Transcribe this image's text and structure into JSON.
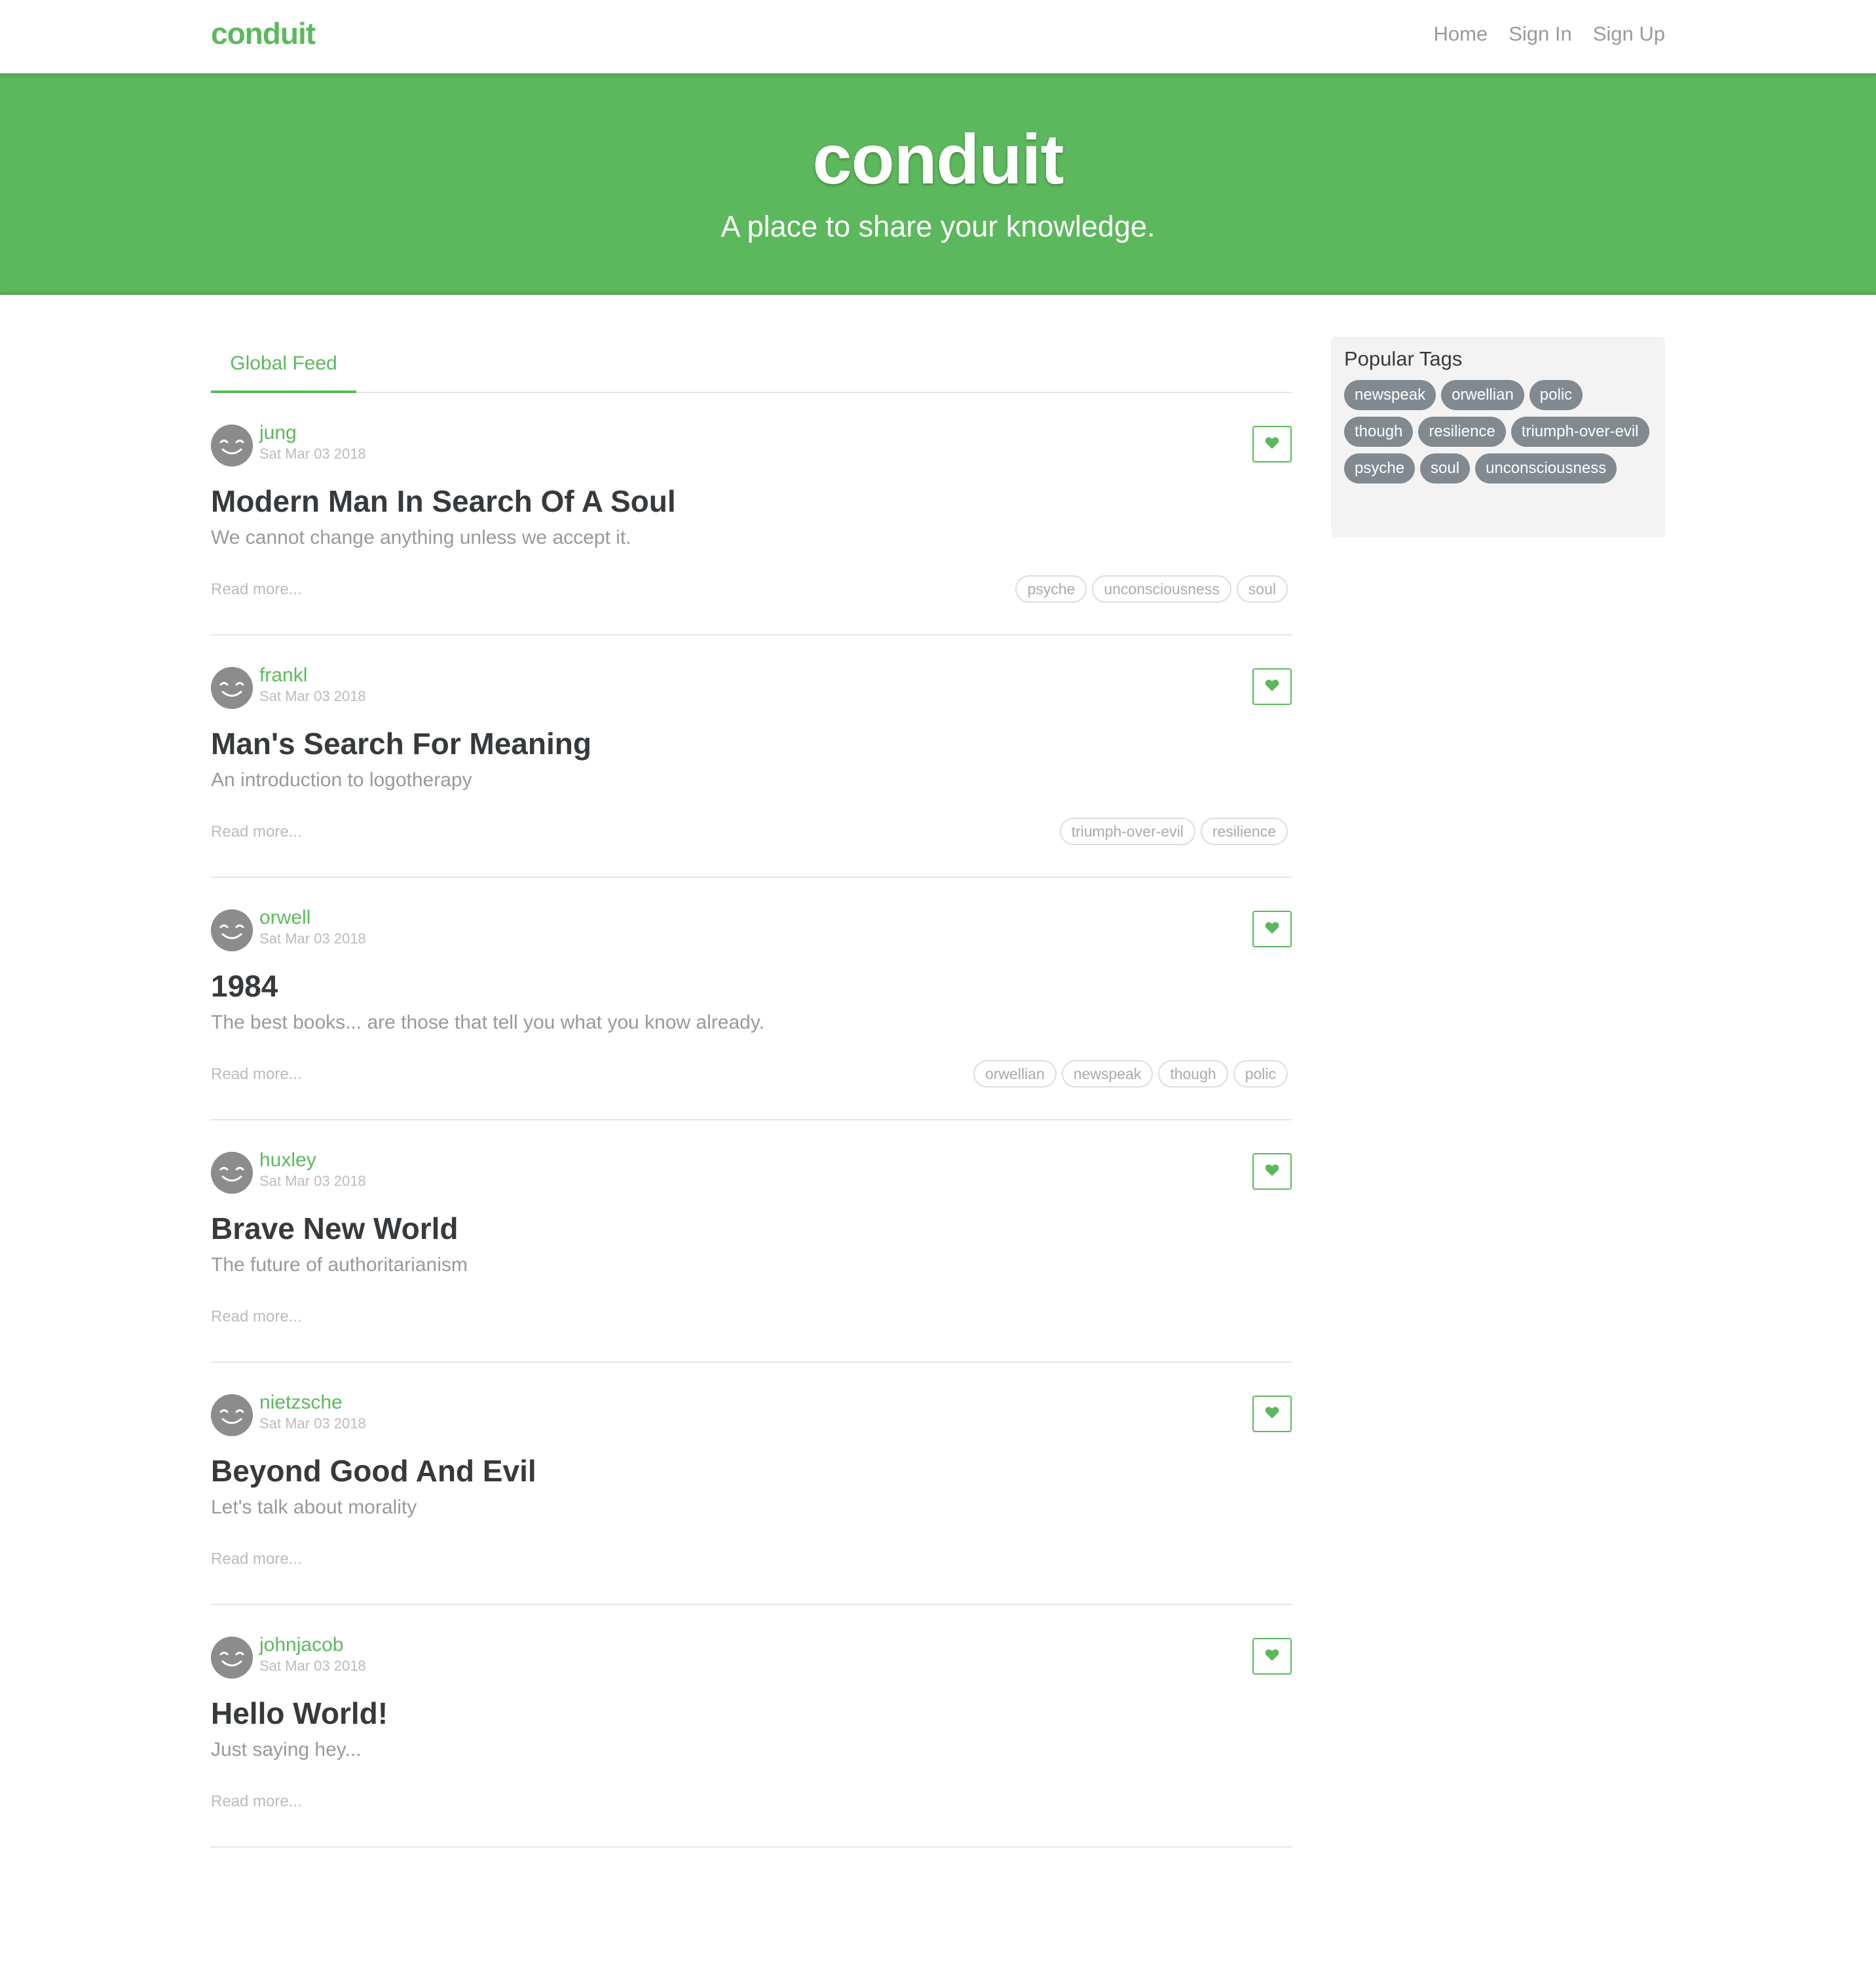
{
  "nav": {
    "brand": "conduit",
    "links": [
      "Home",
      "Sign In",
      "Sign Up"
    ]
  },
  "banner": {
    "title": "conduit",
    "subtitle": "A place to share your knowledge."
  },
  "feed": {
    "tab": "Global Feed",
    "read_more": "Read more...",
    "articles": [
      {
        "author": "jung",
        "date": "Sat Mar 03 2018",
        "title": "Modern Man In Search Of A Soul",
        "description": "We cannot change anything unless we accept it.",
        "tags": [
          "psyche",
          "unconsciousness",
          "soul"
        ]
      },
      {
        "author": "frankl",
        "date": "Sat Mar 03 2018",
        "title": "Man's Search For Meaning",
        "description": "An introduction to logotherapy",
        "tags": [
          "triumph-over-evil",
          "resilience"
        ]
      },
      {
        "author": "orwell",
        "date": "Sat Mar 03 2018",
        "title": "1984",
        "description": "The best books... are those that tell you what you know already.",
        "tags": [
          "orwellian",
          "newspeak",
          "though",
          "polic"
        ]
      },
      {
        "author": "huxley",
        "date": "Sat Mar 03 2018",
        "title": "Brave New World",
        "description": "The future of authoritarianism",
        "tags": []
      },
      {
        "author": "nietzsche",
        "date": "Sat Mar 03 2018",
        "title": "Beyond Good And Evil",
        "description": "Let's talk about morality",
        "tags": []
      },
      {
        "author": "johnjacob",
        "date": "Sat Mar 03 2018",
        "title": "Hello World!",
        "description": "Just saying hey...",
        "tags": []
      }
    ]
  },
  "sidebar": {
    "title": "Popular Tags",
    "tags": [
      "newspeak",
      "orwellian",
      "polic",
      "though",
      "resilience",
      "triumph-over-evil",
      "psyche",
      "soul",
      "unconsciousness"
    ]
  },
  "colors": {
    "brand": "#5cb85c",
    "tag_pill": "#818a91"
  },
  "icons": {
    "favorite": "heart-icon",
    "avatar": "smiley-avatar-icon"
  }
}
